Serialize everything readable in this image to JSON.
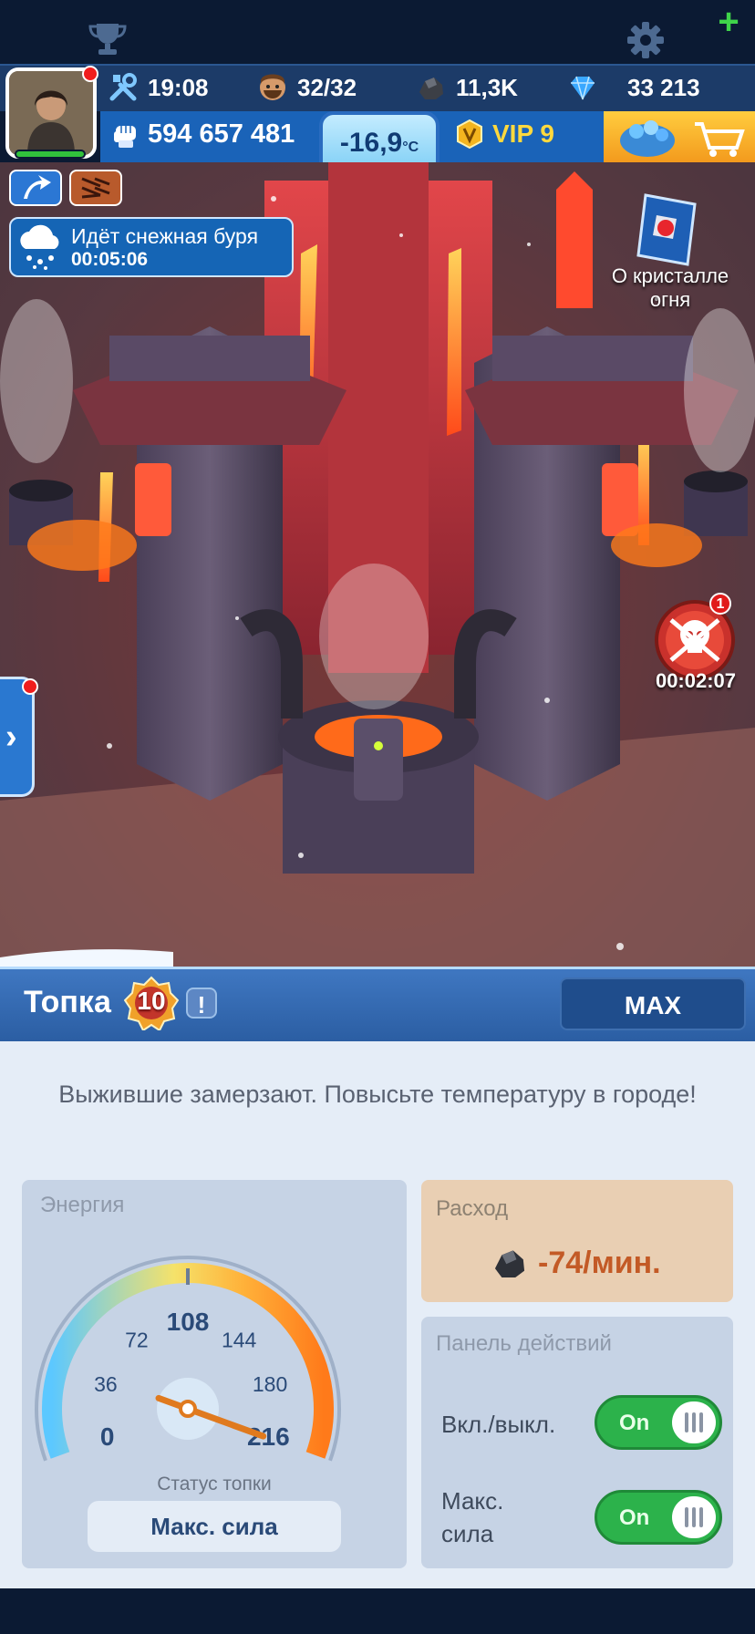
{
  "resources": {
    "timer": "19:08",
    "survivors": "32/32",
    "coal": "11,3K",
    "gems": "33 213",
    "power": "594 657 481",
    "temperature": "-16,9",
    "temperature_unit": "°C",
    "vip": "VIP 9"
  },
  "colors": {
    "accent_blue": "#1a63b8",
    "toggle_on": "#2cb24b",
    "cost_text": "#c35a26",
    "vip_gold": "#ffd93e"
  },
  "scene": {
    "storm_title": "Идёт снежная буря",
    "storm_timer": "00:05:06",
    "crystal_label": "О кристалле огня",
    "raid_count": "1",
    "raid_timer": "00:02:07"
  },
  "building": {
    "name": "Топка",
    "level": "10",
    "info_label": "!",
    "max_label": "MAX",
    "message": "Выжившие замерзают. Повысьте температуру в городе!"
  },
  "energy": {
    "title": "Энергия",
    "ticks": [
      "0",
      "36",
      "72",
      "108",
      "144",
      "180",
      "216"
    ],
    "value": 216,
    "max": 216,
    "status_label": "Статус топки",
    "status_value": "Макс. сила"
  },
  "cost": {
    "title": "Расход",
    "value": "-74",
    "unit": "/мин."
  },
  "actions": {
    "title": "Панель действий",
    "items": [
      {
        "label": "Вкл./выкл.",
        "state": "On"
      },
      {
        "label": "Макс. сила",
        "state": "On"
      }
    ]
  }
}
